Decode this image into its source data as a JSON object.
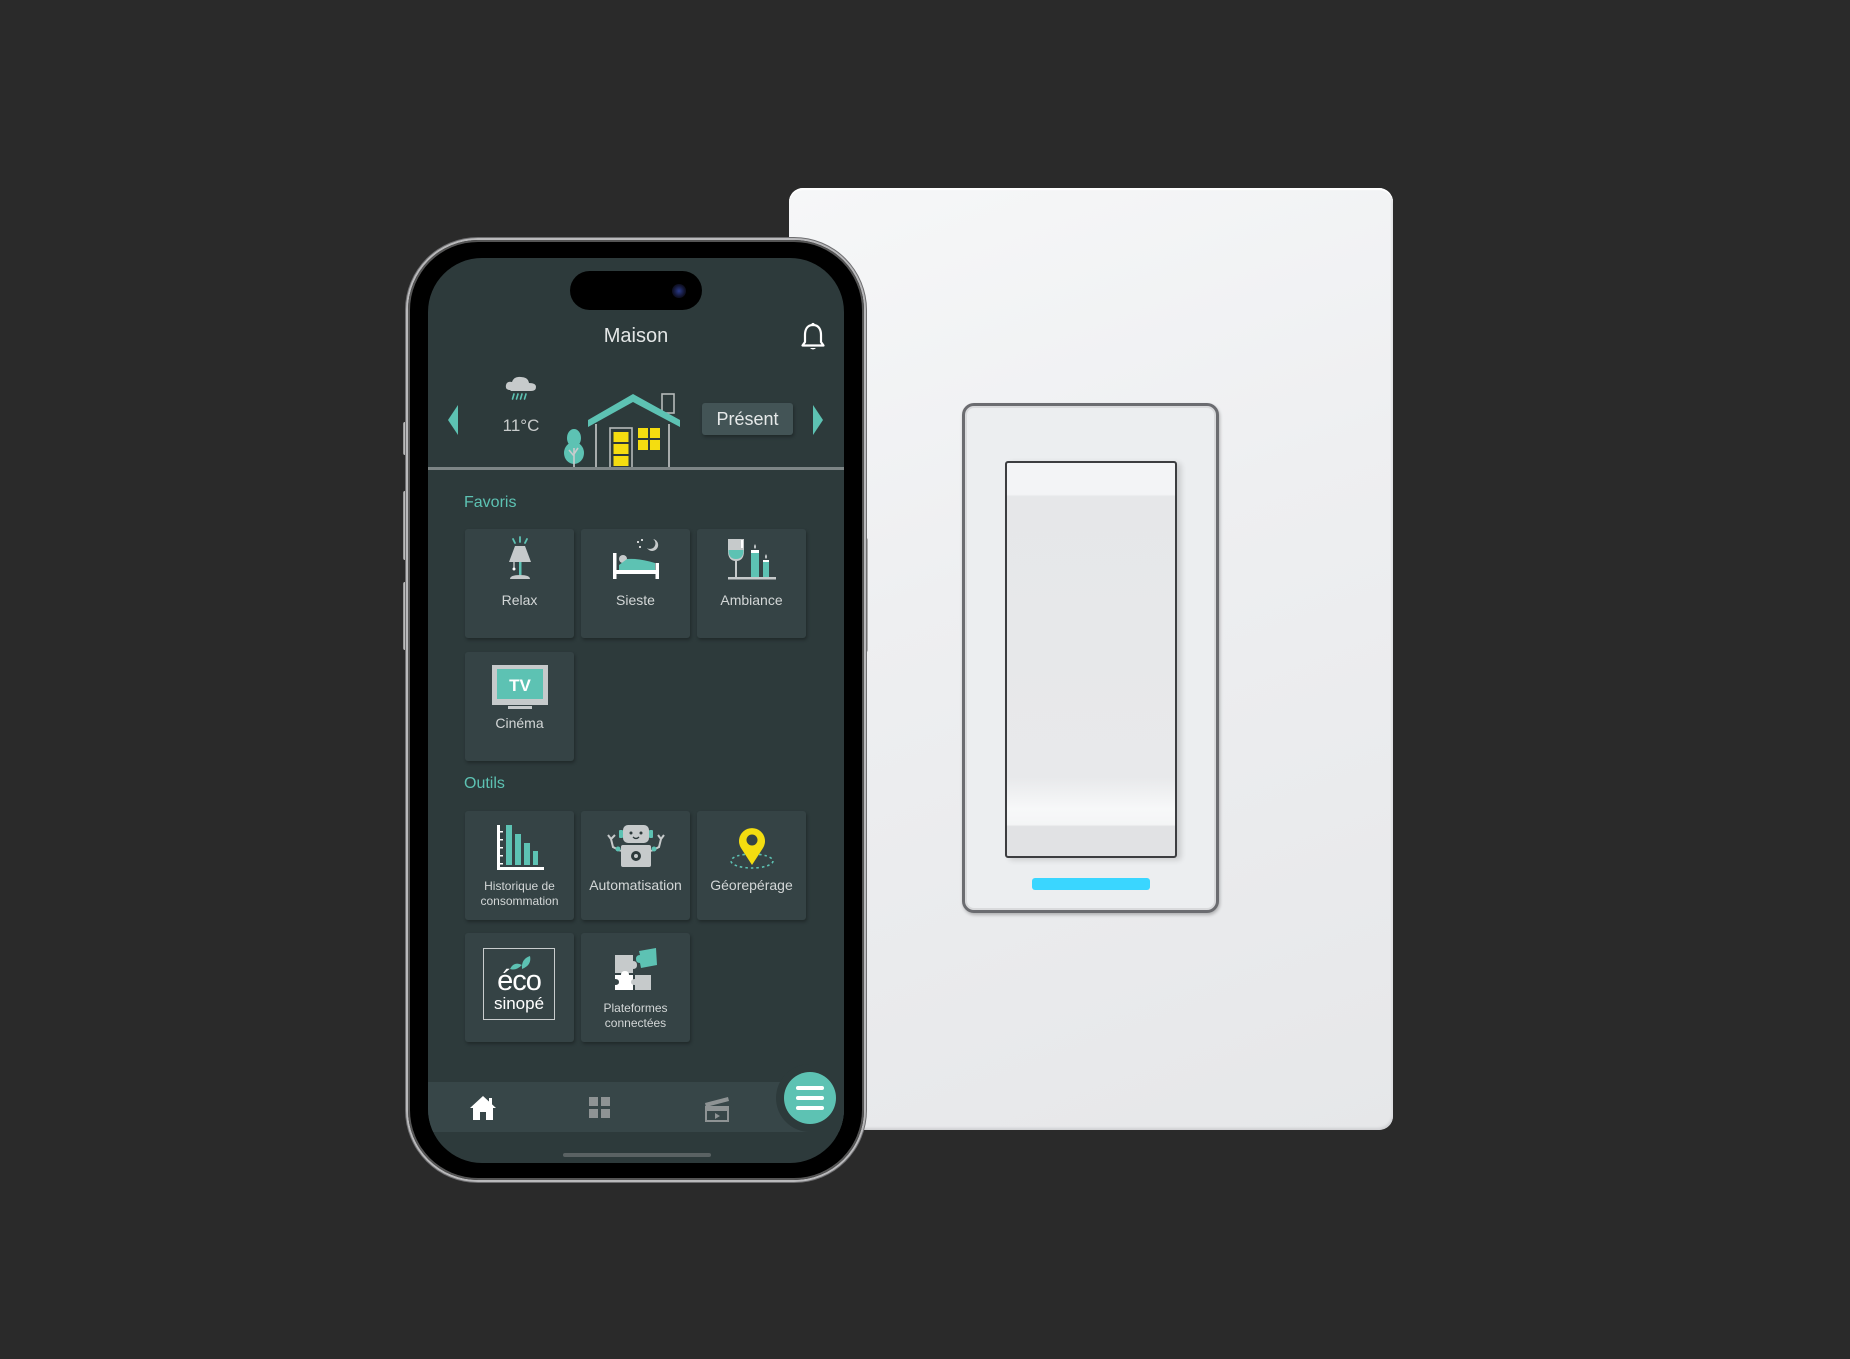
{
  "app": {
    "title": "Maison",
    "weather": {
      "icon": "rain-cloud-icon",
      "temperature": "11°C"
    },
    "presence_mode": "Présent",
    "accent_color": "#5dc2b3",
    "led_color": "#3ad6ff"
  },
  "favorites": {
    "heading": "Favoris",
    "items": [
      {
        "label": "Relax",
        "icon": "lamp-icon"
      },
      {
        "label": "Sieste",
        "icon": "bed-icon"
      },
      {
        "label": "Ambiance",
        "icon": "wine-candles-icon"
      },
      {
        "label": "Cinéma",
        "icon": "tv-icon",
        "icon_text": "TV"
      }
    ]
  },
  "tools": {
    "heading": "Outils",
    "items": [
      {
        "label": "Historique de consommation",
        "icon": "bar-chart-icon"
      },
      {
        "label": "Automatisation",
        "icon": "robot-icon"
      },
      {
        "label": "Géorepérage",
        "icon": "map-pin-icon"
      },
      {
        "label": "",
        "icon": "eco-sinope-logo",
        "logo_line1": "éco",
        "logo_line2": "sinopé"
      },
      {
        "label": "Plateformes connectées",
        "icon": "puzzle-icon"
      }
    ]
  },
  "bottom_nav": {
    "items": [
      {
        "name": "home",
        "icon": "home-icon",
        "active": true
      },
      {
        "name": "devices",
        "icon": "grid-icon",
        "active": false
      },
      {
        "name": "scenes",
        "icon": "clapperboard-icon",
        "active": false
      }
    ],
    "menu_icon": "hamburger-icon"
  }
}
